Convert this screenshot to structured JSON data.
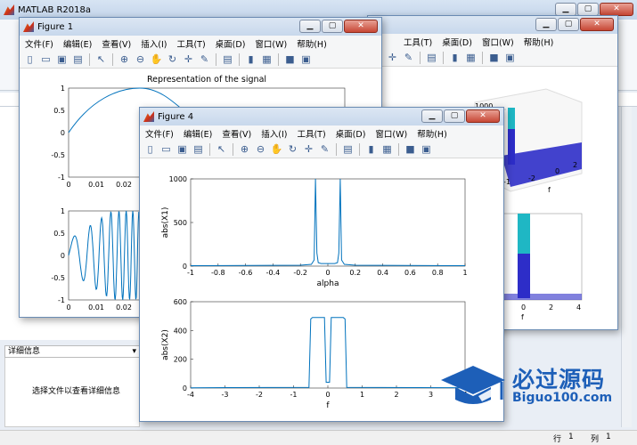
{
  "matlab": {
    "title": "MATLAB R2018a",
    "details_panel_title": "详细信息",
    "details_hint": "选择文件以查看详细信息",
    "status_row_label": "行",
    "status_row_value": "1",
    "status_col_label": "列",
    "status_col_value": "1"
  },
  "menus": [
    "文件(F)",
    "编辑(E)",
    "查看(V)",
    "插入(I)",
    "工具(T)",
    "桌面(D)",
    "窗口(W)",
    "帮助(H)"
  ],
  "hidden_figure": {
    "menus_visible": [
      "工具(T)",
      "桌面(D)",
      "窗口(W)",
      "帮助(H)"
    ],
    "ticks_3d_top": [
      "1000",
      "-1",
      "-2",
      "0",
      "2"
    ],
    "xlabel_top": "f",
    "ticks_bottom_x": [
      "0",
      "2",
      "4"
    ],
    "xlabel_bottom": "f"
  },
  "figure1": {
    "title": "Figure 1",
    "menus_visible": [
      "文件(F)",
      "编辑(E)",
      "查看(V)",
      "插入(I)",
      "工具(T)",
      "桌面(D)",
      "窗口(W)",
      "帮助(H)"
    ],
    "plot1_title": "Representation of the signal",
    "plot1_yticks": [
      "1",
      "0.5",
      "0",
      "-0.5",
      "-1"
    ],
    "plot1_xticks": [
      "0",
      "0.01",
      "0.02"
    ],
    "plot2_yticks": [
      "1",
      "0.5",
      "0",
      "-0.5",
      "-1"
    ],
    "plot2_xticks": [
      "0",
      "0.01",
      "0.02"
    ]
  },
  "figure4": {
    "title": "Figure 4",
    "menus": [
      "文件(F)",
      "编辑(E)",
      "查看(V)",
      "插入(I)",
      "工具(T)",
      "桌面(D)",
      "窗口(W)",
      "帮助(H)"
    ],
    "chart_data": [
      {
        "type": "line",
        "ylabel": "abs(X1)",
        "xlabel": "alpha",
        "xlim": [
          -1,
          1
        ],
        "ylim": [
          0,
          1000
        ],
        "xticks": [
          "-1",
          "-0.8",
          "-0.6",
          "-0.4",
          "-0.2",
          "0",
          "0.2",
          "0.4",
          "0.6",
          "0.8",
          "1"
        ],
        "yticks": [
          "0",
          "500",
          "1000"
        ],
        "x": [
          -1,
          -0.2,
          -0.12,
          -0.1,
          -0.09,
          -0.08,
          -0.07,
          -0.05,
          0.05,
          0.07,
          0.08,
          0.09,
          0.1,
          0.12,
          0.2,
          1
        ],
        "y": [
          5,
          10,
          20,
          70,
          1000,
          150,
          40,
          30,
          30,
          40,
          150,
          1000,
          70,
          20,
          10,
          5
        ]
      },
      {
        "type": "line",
        "ylabel": "abs(X2)",
        "xlabel": "f",
        "xlim": [
          -4,
          4
        ],
        "ylim": [
          0,
          600
        ],
        "xticks": [
          "-4",
          "-3",
          "-2",
          "-1",
          "0",
          "1",
          "2",
          "3",
          "4"
        ],
        "yticks": [
          "0",
          "200",
          "400",
          "600"
        ],
        "x": [
          -4,
          -0.55,
          -0.5,
          -0.45,
          -0.1,
          -0.05,
          0.05,
          0.1,
          0.45,
          0.5,
          0.55,
          4
        ],
        "y": [
          2,
          5,
          480,
          490,
          490,
          40,
          40,
          490,
          490,
          480,
          5,
          2
        ]
      }
    ]
  },
  "logo": {
    "cn": "必过源码",
    "en": "Biguo100.com"
  }
}
